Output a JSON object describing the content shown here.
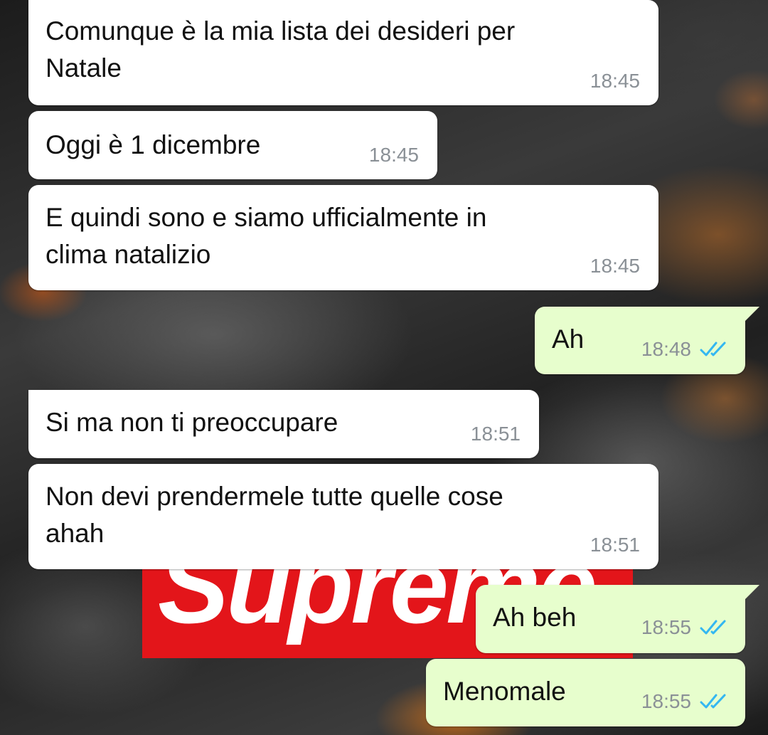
{
  "wallpaper": {
    "logo_text": "Supreme",
    "logo_color": "#e3151a"
  },
  "colors": {
    "incoming_bubble": "#ffffff",
    "outgoing_bubble": "#e7fecd",
    "read_ticks": "#34b7f1",
    "timestamp": "#8a9096"
  },
  "messages": [
    {
      "direction": "incoming",
      "lines": [
        "Comunque è la mia lista dei desideri per",
        "Natale"
      ],
      "time": "18:45"
    },
    {
      "direction": "incoming",
      "lines": [
        "Oggi è 1 dicembre"
      ],
      "time": "18:45"
    },
    {
      "direction": "incoming",
      "lines": [
        "E quindi sono e siamo ufficialmente in",
        "clima natalizio"
      ],
      "time": "18:45"
    },
    {
      "direction": "outgoing",
      "lines": [
        "Ah"
      ],
      "time": "18:48",
      "status_icon": "double-check-read-icon"
    },
    {
      "direction": "incoming",
      "lines": [
        "Si ma non ti preoccupare"
      ],
      "time": "18:51"
    },
    {
      "direction": "incoming",
      "lines": [
        "Non devi prendermele tutte quelle cose",
        "ahah"
      ],
      "time": "18:51"
    },
    {
      "direction": "outgoing",
      "lines": [
        "Ah beh"
      ],
      "time": "18:55",
      "status_icon": "double-check-read-icon"
    },
    {
      "direction": "outgoing",
      "lines": [
        "Menomale"
      ],
      "time": "18:55",
      "status_icon": "double-check-read-icon"
    }
  ]
}
